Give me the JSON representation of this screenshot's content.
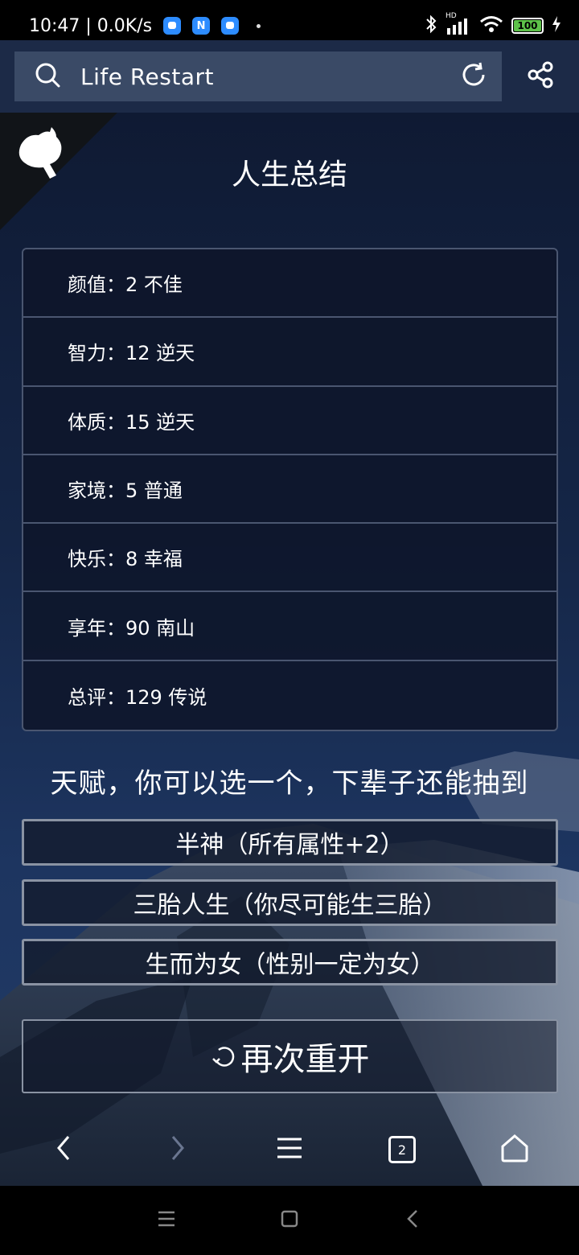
{
  "status_bar": {
    "time_speed": "10:47 | 0.0K/s",
    "notification_icons": [
      "chat-icon",
      "n-app-icon",
      "chat-icon"
    ],
    "notif_letter": "N",
    "signal_label": "HD",
    "battery_level": "100"
  },
  "browser": {
    "url": "Life Restart",
    "icons": [
      "search-icon",
      "refresh-icon",
      "share-icon"
    ]
  },
  "page": {
    "title": "人生总结",
    "summary": [
      {
        "label": "颜值：2 不佳"
      },
      {
        "label": "智力：12 逆天"
      },
      {
        "label": "体质：15 逆天"
      },
      {
        "label": "家境：5 普通"
      },
      {
        "label": "快乐：8 幸福"
      },
      {
        "label": "享年：90 南山"
      },
      {
        "label": "总评：129 传说"
      }
    ],
    "talent_heading": "天赋，你可以选一个，下辈子还能抽到",
    "talents": [
      "半神（所有属性+2）",
      "三胎人生（你尽可能生三胎）",
      "生而为女（性别一定为女）"
    ],
    "restart_label": "再次重开"
  },
  "browser_nav": {
    "tab_count": "2",
    "icons": [
      "back-icon",
      "forward-icon",
      "menu-icon",
      "tabs-icon",
      "home-icon"
    ]
  },
  "system_nav": {
    "icons": [
      "recents-icon",
      "home-icon",
      "back-icon"
    ]
  },
  "colors": {
    "background": "#0f1a33",
    "browser_bar": "#1c2a47",
    "url_box": "#3a4a66",
    "table_border": "#4a5670",
    "button_border": "#8a93a3",
    "battery_fill": "#5ec24a"
  }
}
